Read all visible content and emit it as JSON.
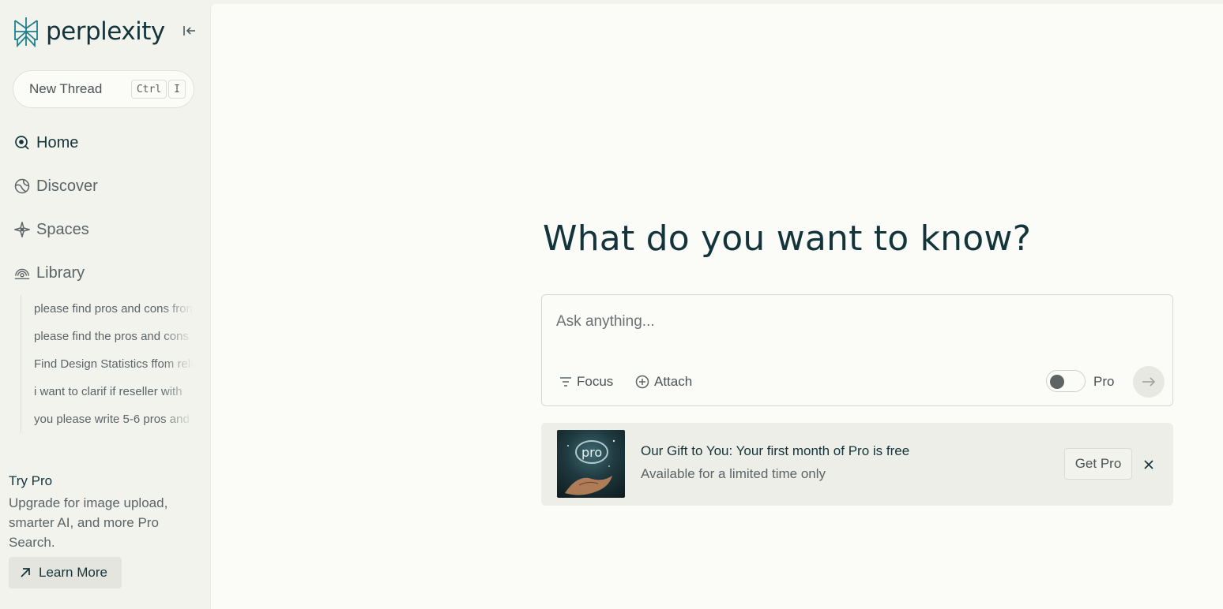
{
  "sidebar": {
    "logo_text": "perplexity",
    "new_thread": {
      "label": "New Thread",
      "shortcut_keys": [
        "Ctrl",
        "I"
      ]
    },
    "nav": [
      {
        "label": "Home",
        "icon": "search-circle-icon",
        "active": true
      },
      {
        "label": "Discover",
        "icon": "globe-icon",
        "active": false
      },
      {
        "label": "Spaces",
        "icon": "sparkle-icon",
        "active": false
      },
      {
        "label": "Library",
        "icon": "library-icon",
        "active": false
      }
    ],
    "library_items": [
      "please find pros and cons from",
      "please find the pros and cons of",
      "Find Design Statistics ffom reliable",
      "i want to clarif if reseller with",
      "you please write 5-6 pros and"
    ],
    "try_pro": {
      "title": "Try Pro",
      "description": "Upgrade for image upload, smarter AI, and more Pro Search.",
      "learn_more": "Learn More"
    }
  },
  "main": {
    "headline": "What do you want to know?",
    "ask": {
      "placeholder": "Ask anything...",
      "focus_label": "Focus",
      "attach_label": "Attach",
      "pro_label": "Pro",
      "pro_enabled": false
    },
    "promo": {
      "title": "Our Gift to You: Your first month of Pro is free",
      "subtitle": "Available for a limited time only",
      "button": "Get Pro",
      "image_text": "pro"
    }
  },
  "colors": {
    "sidebar_bg": "#f3f3ee",
    "main_bg": "#fbfbf8",
    "brand": "#13343b",
    "logo_accent": "#20808d"
  }
}
